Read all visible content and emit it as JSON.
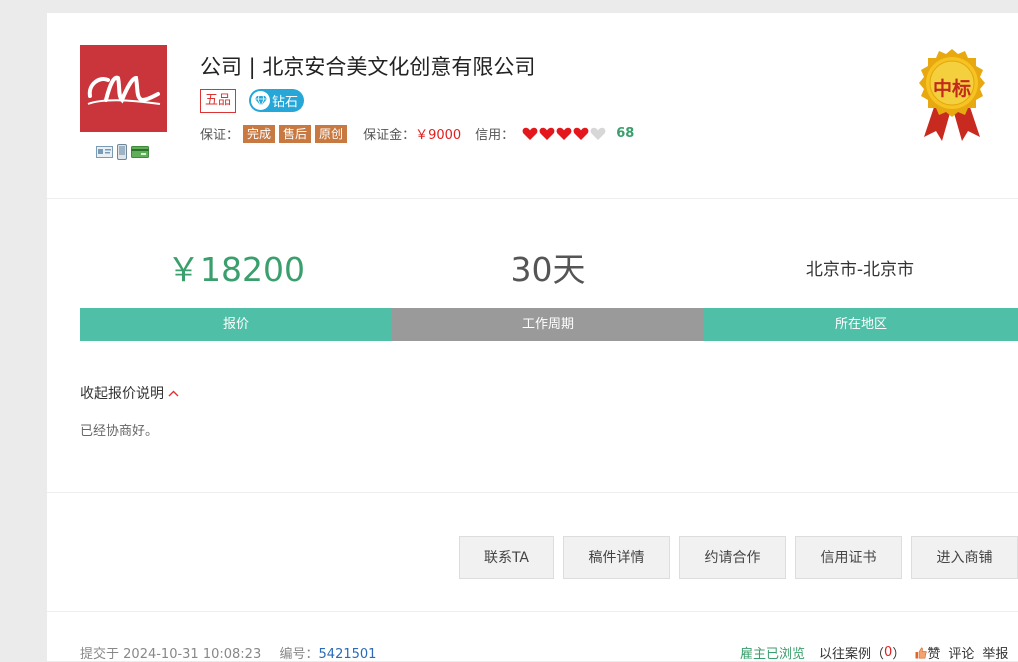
{
  "company": {
    "title": "公司 | 北京安合美文化创意有限公司",
    "grade": "五品",
    "level": "钻石",
    "guarantee_label": "保证：",
    "guarantee_tags": [
      "完成",
      "售后",
      "原创"
    ],
    "deposit_label": "保证金：",
    "deposit_value": "￥9000",
    "credit_label": "信用：",
    "credit_hearts": 4,
    "credit_max": 5,
    "credit_score": "68",
    "medal_text": "中标"
  },
  "stats": {
    "price": "￥18200",
    "period": "30天",
    "region": "北京市-北京市",
    "price_label": "报价",
    "period_label": "工作周期",
    "region_label": "所在地区"
  },
  "quote": {
    "toggle_label": "收起报价说明",
    "description": "已经协商好。"
  },
  "buttons": {
    "contact": "联系TA",
    "details": "稿件详情",
    "invite": "约请合作",
    "credentials": "信用证书",
    "shop": "进入商铺"
  },
  "footer": {
    "submitted_label": "提交于",
    "submitted_time": "2024-10-31 10:08:23",
    "id_label": "编号：",
    "id_value": "5421501",
    "viewed": "雇主已浏览",
    "past_cases_label": "以往案例（",
    "past_cases_count": "0",
    "past_cases_close": "）",
    "like": "赞",
    "comment": "评论",
    "report": "举报"
  },
  "colors": {
    "accent_green": "#4fbfa7",
    "period_gray": "#9a9a9a",
    "price_green": "#3a9f6c",
    "logo_red": "#c9353a",
    "tag_orange": "#c87941"
  }
}
